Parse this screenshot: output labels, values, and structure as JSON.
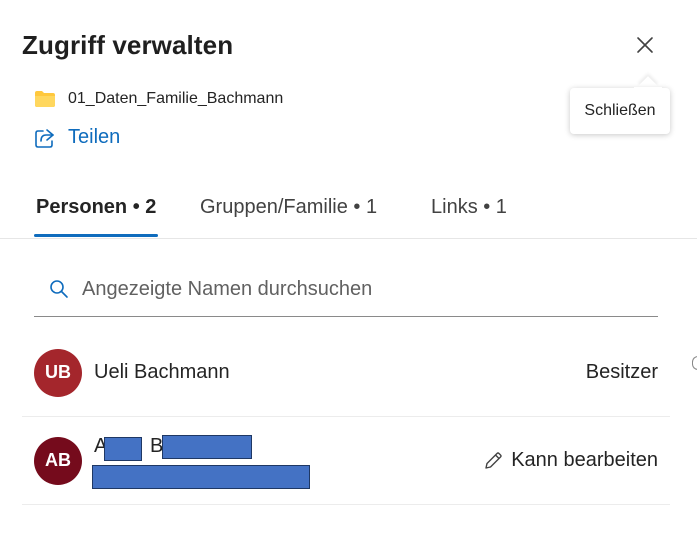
{
  "panel": {
    "title": "Zugriff verwalten",
    "close_tooltip": "Schließen",
    "folder_name": "01_Daten_Familie_Bachmann",
    "share_label": "Teilen"
  },
  "tabs": [
    {
      "label": "Personen • 2",
      "active": true
    },
    {
      "label": "Gruppen/Familie • 1",
      "active": false
    },
    {
      "label": "Links • 1",
      "active": false
    }
  ],
  "search": {
    "placeholder": "Angezeigte Namen durchsuchen",
    "value": ""
  },
  "people": [
    {
      "initials": "UB",
      "name": "Ueli Bachmann",
      "role": "Besitzer",
      "avatar_color": "#a4262c"
    },
    {
      "initials": "AB",
      "name_first_char": "A",
      "name_second_char": "B",
      "role": "Kann bearbeiten",
      "avatar_color": "#750b1c"
    }
  ],
  "colors": {
    "accent": "#0f6cbd",
    "folder": "#ffc83d",
    "redaction": "#4472c4"
  },
  "icons": {
    "close": "close-icon",
    "folder": "folder-icon",
    "share": "share-icon",
    "search": "search-icon",
    "edit": "pencil-icon"
  }
}
